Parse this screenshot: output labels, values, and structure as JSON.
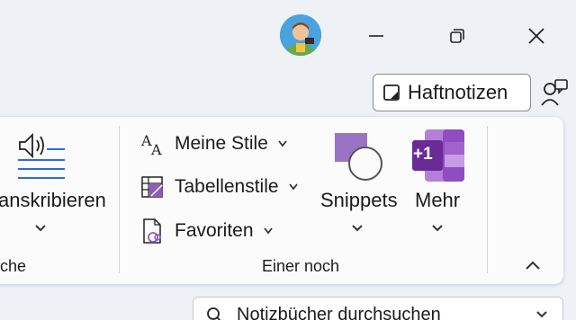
{
  "window": {
    "minimize_glyph": "—",
    "restore_icon": "restore-icon",
    "close_icon": "close-icon"
  },
  "toolbar": {
    "sticky_notes_label": "Haftnotizen"
  },
  "ribbon": {
    "transcribe_label": "anskribieren",
    "group_left_label": "che",
    "my_styles_label": "Meine Stile",
    "table_styles_label": "Tabellenstile",
    "favorites_label": "Favoriten",
    "snippets_label": "Snippets",
    "more_label": "Mehr",
    "more_badge": "+1",
    "group_label": "Einer noch"
  },
  "search": {
    "placeholder": "Notizbücher durchsuchen"
  },
  "colors": {
    "accent_onenote": "#7b2fa8",
    "accent_blue": "#2b6cd6"
  }
}
